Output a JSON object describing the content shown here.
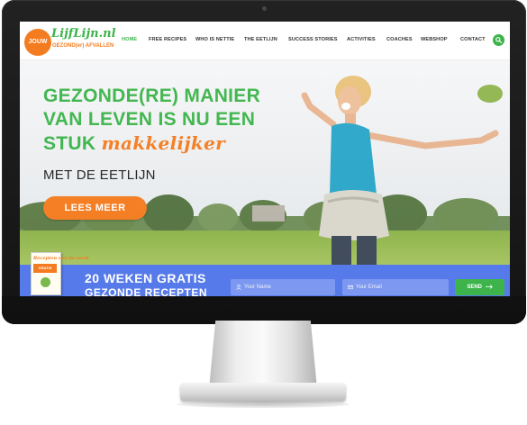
{
  "logo": {
    "badge": "JOUW",
    "name": "LijfLijn.nl",
    "tagline": "GEZOND(er) AFVALLEN"
  },
  "nav": {
    "items": [
      "HOME",
      "FREE RECIPES",
      "WHO IS NETTIE",
      "THE EETLIJN",
      "SUCCESS STORIES",
      "ACTIVITIES",
      "COACHES",
      "WEBSHOP",
      "CONTACT"
    ],
    "active": "HOME",
    "search_icon": "search-icon"
  },
  "hero": {
    "headline_line1": "GEZONDE(RE) MANIER",
    "headline_line2": "VAN LEVEN IS NU EEN",
    "headline_line3_a": "STUK",
    "headline_line3_b": "makkelijker",
    "subline": "MET DE EETLIJN",
    "cta_label": "LEES MEER"
  },
  "newsletter": {
    "title": "20 WEKEN GRATIS",
    "subtitle": "GEZONDE RECEPTEN",
    "book_title": "Recepten van de week",
    "book_badge": "GRATIS",
    "name_placeholder": "Your Name",
    "email_placeholder": "Your Email",
    "send_label": "SEND"
  },
  "colors": {
    "green": "#3cb44a",
    "orange": "#f47c20",
    "blue_bar": "#5579ea"
  }
}
